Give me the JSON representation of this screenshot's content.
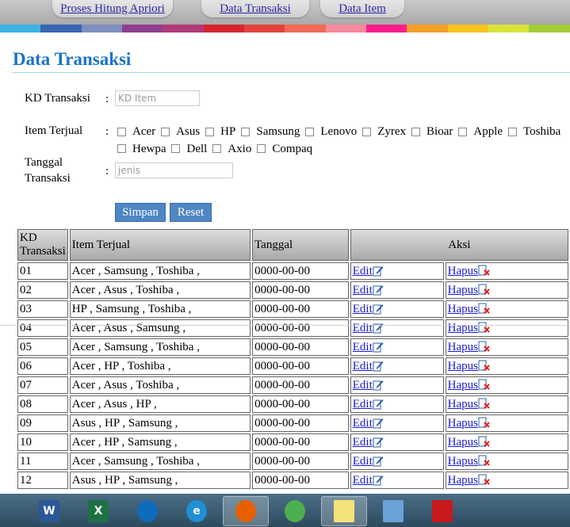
{
  "nav": {
    "items": [
      {
        "label": "Proses Hitung Apriori"
      },
      {
        "label": "Data Transaksi"
      },
      {
        "label": "Data Item"
      }
    ]
  },
  "band_colors": [
    "#3fb3e6",
    "#3a66b3",
    "#7e8fbf",
    "#8e3f8e",
    "#b23a7a",
    "#d7252f",
    "#e2443c",
    "#f06a55",
    "#f58a9c",
    "#ff1f8a",
    "#f59f2a",
    "#f9c21c",
    "#d8e33a",
    "#a3cd3a"
  ],
  "page": {
    "title": "Data Transaksi"
  },
  "form": {
    "kd_label": "KD Transaksi",
    "kd_placeholder": "KD Item",
    "item_label": "Item Terjual",
    "items": [
      "Acer",
      "Asus",
      "HP",
      "Samsung",
      "Lenovo",
      "Zyrex",
      "Bioar",
      "Apple",
      "Toshiba",
      "Hewpa",
      "Dell",
      "Axio",
      "Compaq"
    ],
    "tanggal_label_1": "Tanggal",
    "tanggal_label_2": "Transaksi",
    "tanggal_placeholder": "jenis",
    "colon": ":",
    "save_label": "Simpan",
    "reset_label": "Reset"
  },
  "table": {
    "headers": {
      "kd_1": "KD",
      "kd_2": "Transaksi",
      "item": "Item Terjual",
      "tanggal": "Tanggal",
      "aksi": "Aksi"
    },
    "edit_label": "Edit",
    "delete_label": "Hapus",
    "rows": [
      {
        "kd": "01",
        "items": "Acer , Samsung , Toshiba ,",
        "tanggal": "0000-00-00"
      },
      {
        "kd": "02",
        "items": "Acer , Asus , Toshiba ,",
        "tanggal": "0000-00-00"
      },
      {
        "kd": "03",
        "items": "HP , Samsung , Toshiba ,",
        "tanggal": "0000-00-00"
      },
      {
        "kd": "04",
        "items": "Acer , Asus , Samsung ,",
        "tanggal": "0000-00-00"
      },
      {
        "kd": "05",
        "items": "Acer , Samsung , Toshiba ,",
        "tanggal": "0000-00-00"
      },
      {
        "kd": "06",
        "items": "Acer , HP , Toshiba ,",
        "tanggal": "0000-00-00"
      },
      {
        "kd": "07",
        "items": "Acer , Asus , Toshiba ,",
        "tanggal": "0000-00-00"
      },
      {
        "kd": "08",
        "items": "Acer , Asus , HP ,",
        "tanggal": "0000-00-00"
      },
      {
        "kd": "09",
        "items": "Asus , HP , Samsung ,",
        "tanggal": "0000-00-00"
      },
      {
        "kd": "10",
        "items": "Acer , HP , Samsung ,",
        "tanggal": "0000-00-00"
      },
      {
        "kd": "11",
        "items": "Acer , Samsung , Toshiba ,",
        "tanggal": "0000-00-00"
      },
      {
        "kd": "12",
        "items": "Asus , HP , Samsung ,",
        "tanggal": "0000-00-00"
      }
    ]
  },
  "taskbar": {
    "apps": [
      {
        "name": "word-icon",
        "text": "W",
        "color": "#2b5797"
      },
      {
        "name": "excel-icon",
        "text": "X",
        "color": "#1e7145"
      },
      {
        "name": "onedrive-icon",
        "text": "",
        "color": "#0f6cbd"
      },
      {
        "name": "ie-icon",
        "text": "e",
        "color": "#1f8fd6"
      },
      {
        "name": "firefox-icon",
        "text": "",
        "color": "#e66000"
      },
      {
        "name": "chrome-icon",
        "text": "",
        "color": "#4caf50"
      },
      {
        "name": "sticky-notes-icon",
        "text": "",
        "color": "#f3e27a"
      },
      {
        "name": "control-panel-icon",
        "text": "",
        "color": "#6aa2d8"
      },
      {
        "name": "pdf-icon",
        "text": "",
        "color": "#c8191c"
      }
    ]
  }
}
